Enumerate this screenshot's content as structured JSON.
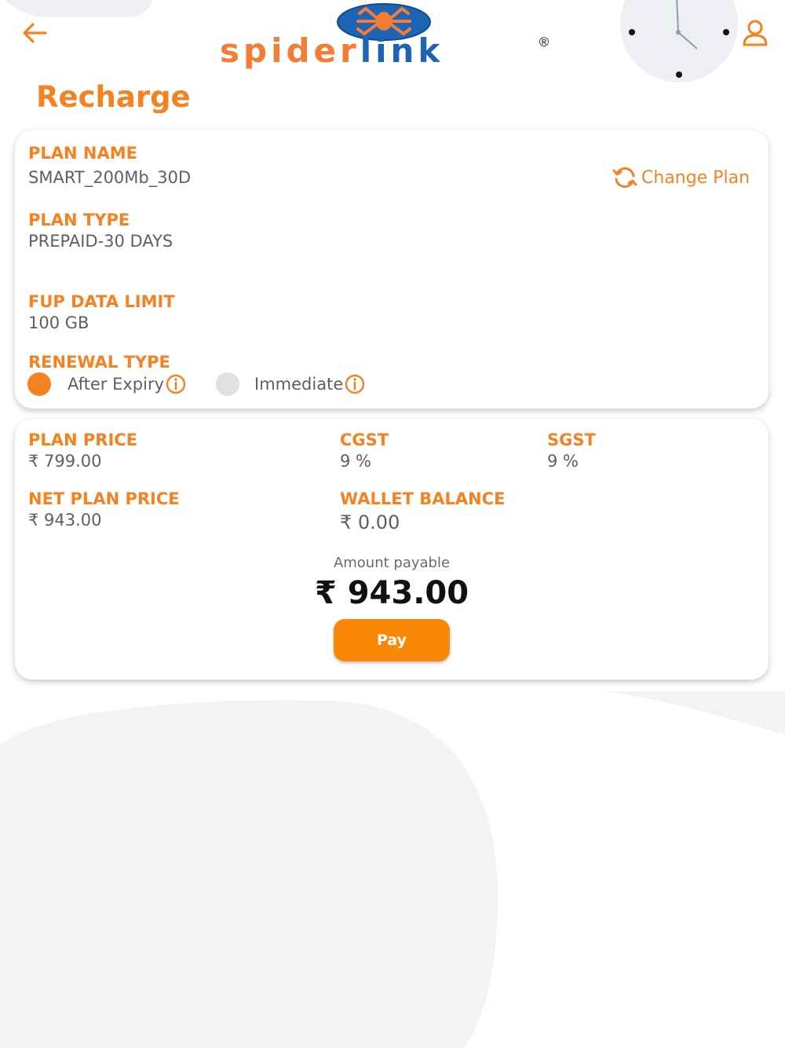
{
  "header": {
    "brand": {
      "part1": "spider",
      "part2": "link",
      "reg_mark": "®"
    },
    "page_title": "Recharge"
  },
  "plan_card": {
    "plan_name_label": "PLAN NAME",
    "plan_name": "SMART_200Mb_30D",
    "change_plan_label": "Change Plan",
    "plan_type_label": "PLAN TYPE",
    "plan_type": "PREPAID-30 DAYS",
    "fup_label": "FUP DATA LIMIT",
    "fup_value": "100 GB",
    "renewal_label": "RENEWAL TYPE",
    "renewal_options": [
      {
        "label": "After Expiry",
        "selected": true
      },
      {
        "label": "Immediate",
        "selected": false
      }
    ]
  },
  "price_card": {
    "plan_price_label": "PLAN PRICE",
    "plan_price": "₹ 799.00",
    "cgst_label": "CGST",
    "cgst_value": "9 %",
    "sgst_label": "SGST",
    "sgst_value": "9 %",
    "net_price_label": "NET PLAN PRICE",
    "net_price": "₹ 943.00",
    "wallet_label": "WALLET BALANCE",
    "wallet_value": "₹ 0.00",
    "amount_payable_label": "Amount payable",
    "amount_payable": "₹ 943.00",
    "pay_label": "Pay"
  },
  "colors": {
    "accent": "#f58220",
    "button": "#f98806",
    "logo_blue": "#1d64b4",
    "text_grey": "#5f5f5f",
    "background_shape": "#f2f3f5"
  },
  "icons": [
    "back-arrow-icon",
    "spider-logo-icon",
    "clock-icon",
    "profile-icon",
    "refresh-icon",
    "info-icon"
  ]
}
